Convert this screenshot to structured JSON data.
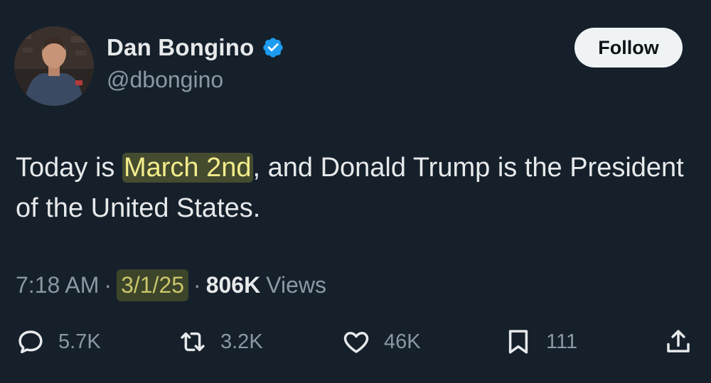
{
  "author": {
    "name": "Dan Bongino",
    "handle": "@dbongino",
    "verified_icon": "verified-badge-icon",
    "avatar": "profile-photo"
  },
  "follow_button": {
    "label": "Follow"
  },
  "tweet": {
    "text_before": "Today is ",
    "highlight": "March 2nd",
    "text_after": ", and Donald Trump is the President of the United States."
  },
  "meta": {
    "time": "7:18 AM",
    "separator": "·",
    "date": "3/1/25",
    "views_count": "806K",
    "views_label": "Views"
  },
  "actions": {
    "replies": {
      "icon": "reply-icon",
      "count": "5.7K"
    },
    "reposts": {
      "icon": "repost-icon",
      "count": "3.2K"
    },
    "likes": {
      "icon": "heart-icon",
      "count": "46K"
    },
    "bookmarks": {
      "icon": "bookmark-icon",
      "count": "111"
    },
    "share": {
      "icon": "share-icon"
    }
  },
  "colors": {
    "background": "#15202b",
    "text": "#e7e9ea",
    "muted": "#8b98a5",
    "verified_blue": "#1d9bf0",
    "highlight_yellow": "#f2ec8c"
  }
}
